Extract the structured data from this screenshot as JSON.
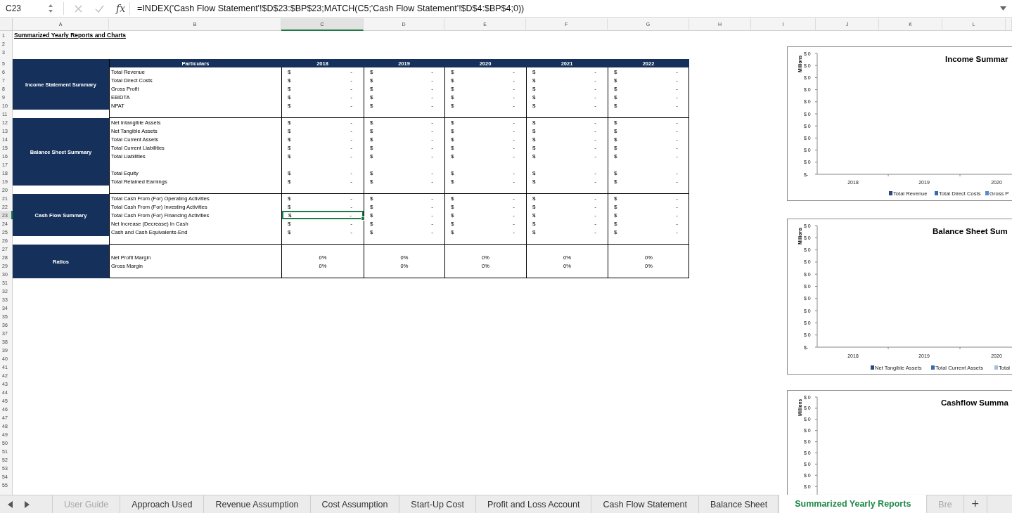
{
  "formula_bar": {
    "name_box": "C23",
    "function_label": "fx",
    "formula": "=INDEX('Cash Flow Statement'!$D$23:$BP$23;MATCH(C5;'Cash Flow Statement'!$D$4:$BP$4;0))"
  },
  "columns": [
    {
      "label": "A",
      "selected": false
    },
    {
      "label": "B",
      "selected": false
    },
    {
      "label": "C",
      "selected": true
    },
    {
      "label": "D",
      "selected": false
    },
    {
      "label": "E",
      "selected": false
    },
    {
      "label": "F",
      "selected": false
    },
    {
      "label": "G",
      "selected": false
    },
    {
      "label": "H",
      "selected": false
    },
    {
      "label": "I",
      "selected": false
    },
    {
      "label": "J",
      "selected": false
    },
    {
      "label": "K",
      "selected": false
    },
    {
      "label": "L",
      "selected": false
    }
  ],
  "row_numbers": [
    {
      "label": "1",
      "selected": false
    },
    {
      "label": "2",
      "selected": false
    },
    {
      "label": "3",
      "selected": false
    },
    {
      "label": "5",
      "selected": false
    },
    {
      "label": "6",
      "selected": false
    },
    {
      "label": "7",
      "selected": false
    },
    {
      "label": "8",
      "selected": false
    },
    {
      "label": "9",
      "selected": false
    },
    {
      "label": "10",
      "selected": false
    },
    {
      "label": "11",
      "selected": false
    },
    {
      "label": "12",
      "selected": false
    },
    {
      "label": "13",
      "selected": false
    },
    {
      "label": "14",
      "selected": false
    },
    {
      "label": "15",
      "selected": false
    },
    {
      "label": "16",
      "selected": false
    },
    {
      "label": "17",
      "selected": false
    },
    {
      "label": "18",
      "selected": false
    },
    {
      "label": "19",
      "selected": false
    },
    {
      "label": "20",
      "selected": false
    },
    {
      "label": "21",
      "selected": false
    },
    {
      "label": "22",
      "selected": false
    },
    {
      "label": "23",
      "selected": true
    },
    {
      "label": "24",
      "selected": false
    },
    {
      "label": "25",
      "selected": false
    },
    {
      "label": "26",
      "selected": false
    },
    {
      "label": "27",
      "selected": false
    },
    {
      "label": "28",
      "selected": false
    },
    {
      "label": "29",
      "selected": false
    },
    {
      "label": "30",
      "selected": false
    },
    {
      "label": "31",
      "selected": false
    },
    {
      "label": "32",
      "selected": false
    },
    {
      "label": "33",
      "selected": false
    },
    {
      "label": "34",
      "selected": false
    },
    {
      "label": "35",
      "selected": false
    },
    {
      "label": "36",
      "selected": false
    },
    {
      "label": "37",
      "selected": false
    },
    {
      "label": "38",
      "selected": false
    },
    {
      "label": "39",
      "selected": false
    },
    {
      "label": "40",
      "selected": false
    },
    {
      "label": "41",
      "selected": false
    },
    {
      "label": "42",
      "selected": false
    },
    {
      "label": "43",
      "selected": false
    },
    {
      "label": "44",
      "selected": false
    },
    {
      "label": "45",
      "selected": false
    },
    {
      "label": "46",
      "selected": false
    },
    {
      "label": "47",
      "selected": false
    },
    {
      "label": "48",
      "selected": false
    },
    {
      "label": "49",
      "selected": false
    },
    {
      "label": "50",
      "selected": false
    },
    {
      "label": "51",
      "selected": false
    },
    {
      "label": "52",
      "selected": false
    },
    {
      "label": "53",
      "selected": false
    },
    {
      "label": "54",
      "selected": false
    },
    {
      "label": "55",
      "selected": false
    }
  ],
  "sheet_title": "Summarized Yearly Reports and Charts",
  "table": {
    "header": "Particulars",
    "years": [
      "2018",
      "2019",
      "2020",
      "2021",
      "2022"
    ],
    "sections": [
      {
        "label": "Income Statement Summary",
        "rows": [
          {
            "kind": "item",
            "label": "Total Revenue",
            "cells": [
              {
                "currency": "$",
                "amount": "-",
                "selected": false
              },
              {
                "currency": "$",
                "amount": "-",
                "selected": false
              },
              {
                "currency": "$",
                "amount": "-",
                "selected": false
              },
              {
                "currency": "$",
                "amount": "-",
                "selected": false
              },
              {
                "currency": "$",
                "amount": "-",
                "selected": false
              }
            ]
          },
          {
            "kind": "item",
            "label": "Total Direct Costs",
            "cells": [
              {
                "currency": "$",
                "amount": "-",
                "selected": false
              },
              {
                "currency": "$",
                "amount": "-",
                "selected": false
              },
              {
                "currency": "$",
                "amount": "-",
                "selected": false
              },
              {
                "currency": "$",
                "amount": "-",
                "selected": false
              },
              {
                "currency": "$",
                "amount": "-",
                "selected": false
              }
            ]
          },
          {
            "kind": "item",
            "label": "Gross Profit",
            "cells": [
              {
                "currency": "$",
                "amount": "-",
                "selected": false
              },
              {
                "currency": "$",
                "amount": "-",
                "selected": false
              },
              {
                "currency": "$",
                "amount": "-",
                "selected": false
              },
              {
                "currency": "$",
                "amount": "-",
                "selected": false
              },
              {
                "currency": "$",
                "amount": "-",
                "selected": false
              }
            ]
          },
          {
            "kind": "item",
            "label": "EBIDTA",
            "cells": [
              {
                "currency": "$",
                "amount": "-",
                "selected": false
              },
              {
                "currency": "$",
                "amount": "-",
                "selected": false
              },
              {
                "currency": "$",
                "amount": "-",
                "selected": false
              },
              {
                "currency": "$",
                "amount": "-",
                "selected": false
              },
              {
                "currency": "$",
                "amount": "-",
                "selected": false
              }
            ]
          },
          {
            "kind": "item",
            "label": "NPAT",
            "cells": [
              {
                "currency": "$",
                "amount": "-",
                "selected": false
              },
              {
                "currency": "$",
                "amount": "-",
                "selected": false
              },
              {
                "currency": "$",
                "amount": "-",
                "selected": false
              },
              {
                "currency": "$",
                "amount": "-",
                "selected": false
              },
              {
                "currency": "$",
                "amount": "-",
                "selected": false
              }
            ]
          }
        ]
      },
      {
        "label": "Balance Sheet Summary",
        "rows": [
          {
            "kind": "item",
            "label": "Net Intangible Assets",
            "cells": [
              {
                "currency": "$",
                "amount": "-",
                "selected": false
              },
              {
                "currency": "$",
                "amount": "-",
                "selected": false
              },
              {
                "currency": "$",
                "amount": "-",
                "selected": false
              },
              {
                "currency": "$",
                "amount": "-",
                "selected": false
              },
              {
                "currency": "$",
                "amount": "-",
                "selected": false
              }
            ]
          },
          {
            "kind": "item",
            "label": "Net Tangible Assets",
            "cells": [
              {
                "currency": "$",
                "amount": "-",
                "selected": false
              },
              {
                "currency": "$",
                "amount": "-",
                "selected": false
              },
              {
                "currency": "$",
                "amount": "-",
                "selected": false
              },
              {
                "currency": "$",
                "amount": "-",
                "selected": false
              },
              {
                "currency": "$",
                "amount": "-",
                "selected": false
              }
            ]
          },
          {
            "kind": "item",
            "label": "Total Current Assets",
            "cells": [
              {
                "currency": "$",
                "amount": "-",
                "selected": false
              },
              {
                "currency": "$",
                "amount": "-",
                "selected": false
              },
              {
                "currency": "$",
                "amount": "-",
                "selected": false
              },
              {
                "currency": "$",
                "amount": "-",
                "selected": false
              },
              {
                "currency": "$",
                "amount": "-",
                "selected": false
              }
            ]
          },
          {
            "kind": "item",
            "label": "Total Current Liabilities",
            "cells": [
              {
                "currency": "$",
                "amount": "-",
                "selected": false
              },
              {
                "currency": "$",
                "amount": "-",
                "selected": false
              },
              {
                "currency": "$",
                "amount": "-",
                "selected": false
              },
              {
                "currency": "$",
                "amount": "-",
                "selected": false
              },
              {
                "currency": "$",
                "amount": "-",
                "selected": false
              }
            ]
          },
          {
            "kind": "item",
            "label": "Total Liabilities",
            "cells": [
              {
                "currency": "$",
                "amount": "-",
                "selected": false
              },
              {
                "currency": "$",
                "amount": "-",
                "selected": false
              },
              {
                "currency": "$",
                "amount": "-",
                "selected": false
              },
              {
                "currency": "$",
                "amount": "-",
                "selected": false
              },
              {
                "currency": "$",
                "amount": "-",
                "selected": false
              }
            ]
          },
          {
            "kind": "gap"
          },
          {
            "kind": "item",
            "label": "Total Equity",
            "cells": [
              {
                "currency": "$",
                "amount": "-",
                "selected": false
              },
              {
                "currency": "$",
                "amount": "-",
                "selected": false
              },
              {
                "currency": "$",
                "amount": "-",
                "selected": false
              },
              {
                "currency": "$",
                "amount": "-",
                "selected": false
              },
              {
                "currency": "$",
                "amount": "-",
                "selected": false
              }
            ]
          },
          {
            "kind": "item",
            "label": "Total Retained Earnings",
            "cells": [
              {
                "currency": "$",
                "amount": "-",
                "selected": false
              },
              {
                "currency": "$",
                "amount": "-",
                "selected": false
              },
              {
                "currency": "$",
                "amount": "-",
                "selected": false
              },
              {
                "currency": "$",
                "amount": "-",
                "selected": false
              },
              {
                "currency": "$",
                "amount": "-",
                "selected": false
              }
            ]
          }
        ]
      },
      {
        "label": "Cash Flow Summary",
        "rows": [
          {
            "kind": "item",
            "label": "Total Cash From (For) Operating Activities",
            "cells": [
              {
                "currency": "$",
                "amount": "-",
                "selected": false
              },
              {
                "currency": "$",
                "amount": "-",
                "selected": false
              },
              {
                "currency": "$",
                "amount": "-",
                "selected": false
              },
              {
                "currency": "$",
                "amount": "-",
                "selected": false
              },
              {
                "currency": "$",
                "amount": "-",
                "selected": false
              }
            ]
          },
          {
            "kind": "item",
            "label": "Total Cash From (For) Investing Activities",
            "cells": [
              {
                "currency": "$",
                "amount": "-",
                "selected": false
              },
              {
                "currency": "$",
                "amount": "-",
                "selected": false
              },
              {
                "currency": "$",
                "amount": "-",
                "selected": false
              },
              {
                "currency": "$",
                "amount": "-",
                "selected": false
              },
              {
                "currency": "$",
                "amount": "-",
                "selected": false
              }
            ]
          },
          {
            "kind": "item",
            "label": "Total Cash From (For) Financing Activities",
            "cells": [
              {
                "currency": "$",
                "amount": "-",
                "selected": true
              },
              {
                "currency": "$",
                "amount": "-",
                "selected": false
              },
              {
                "currency": "$",
                "amount": "-",
                "selected": false
              },
              {
                "currency": "$",
                "amount": "-",
                "selected": false
              },
              {
                "currency": "$",
                "amount": "-",
                "selected": false
              }
            ]
          },
          {
            "kind": "item",
            "label": "Net Increase (Decrease) In Cash",
            "cells": [
              {
                "currency": "$",
                "amount": "-",
                "selected": false
              },
              {
                "currency": "$",
                "amount": "-",
                "selected": false
              },
              {
                "currency": "$",
                "amount": "-",
                "selected": false
              },
              {
                "currency": "$",
                "amount": "-",
                "selected": false
              },
              {
                "currency": "$",
                "amount": "-",
                "selected": false
              }
            ]
          },
          {
            "kind": "item",
            "label": "Cash and Cash Equivalents-End",
            "cells": [
              {
                "currency": "$",
                "amount": "-",
                "selected": false
              },
              {
                "currency": "$",
                "amount": "-",
                "selected": false
              },
              {
                "currency": "$",
                "amount": "-",
                "selected": false
              },
              {
                "currency": "$",
                "amount": "-",
                "selected": false
              },
              {
                "currency": "$",
                "amount": "-",
                "selected": false
              }
            ]
          }
        ]
      },
      {
        "label": "Ratios",
        "rows": [
          {
            "kind": "gap"
          },
          {
            "kind": "ratio",
            "label": "Net Profit Margin",
            "cells": [
              {
                "amount": "0%",
                "selected": false
              },
              {
                "amount": "0%",
                "selected": false
              },
              {
                "amount": "0%",
                "selected": false
              },
              {
                "amount": "0%",
                "selected": false
              },
              {
                "amount": "0%",
                "selected": false
              }
            ]
          },
          {
            "kind": "ratio",
            "label": "Gross Margin",
            "cells": [
              {
                "amount": "0%",
                "selected": false
              },
              {
                "amount": "0%",
                "selected": false
              },
              {
                "amount": "0%",
                "selected": false
              },
              {
                "amount": "0%",
                "selected": false
              },
              {
                "amount": "0%",
                "selected": false
              }
            ]
          },
          {
            "kind": "gap"
          }
        ]
      }
    ]
  },
  "charts": [
    {
      "title": "Income Summar",
      "ylabel": "Millions",
      "yticks": [
        "$ 0",
        "$ 0",
        "$ 0",
        "$ 0",
        "$ 0",
        "$ 0",
        "$ 0",
        "$ 0",
        "$ 0",
        "$ 0",
        "$-"
      ],
      "categories": [
        "2018",
        "2019",
        "2020"
      ],
      "legend": [
        {
          "label": "Total Revenue",
          "color": "#2e4a7d"
        },
        {
          "label": "Total Direct Costs",
          "color": "#3c6aa8"
        },
        {
          "label": "Gross P",
          "color": "#5a8ad0"
        }
      ]
    },
    {
      "title": "Balance Sheet Sum",
      "ylabel": "Millions",
      "yticks": [
        "$ 0",
        "$ 0",
        "$ 0",
        "$ 0",
        "$ 0",
        "$ 0",
        "$ 0",
        "$ 0",
        "$ 0",
        "$ 0",
        "$-"
      ],
      "categories": [
        "2018",
        "2019",
        "2020"
      ],
      "legend": [
        {
          "label": "Net Tangible Assets",
          "color": "#2e4a7d"
        },
        {
          "label": "Total Current Assets",
          "color": "#3c6aa8"
        },
        {
          "label": "Total",
          "color": "#a8bbd8"
        }
      ]
    },
    {
      "title": "Cashflow Summa",
      "ylabel": "Millions",
      "yticks": [
        "$ 0",
        "$ 0",
        "$ 0",
        "$ 0",
        "$ 0",
        "$ 0",
        "$ 0",
        "$ 0",
        "$ 0"
      ]
    }
  ],
  "sheet_tabs": [
    {
      "label": "User Guide",
      "selected": false,
      "faded": true
    },
    {
      "label": "Approach Used",
      "selected": false,
      "faded": false
    },
    {
      "label": "Revenue Assumption",
      "selected": false,
      "faded": false
    },
    {
      "label": "Cost Assumption",
      "selected": false,
      "faded": false
    },
    {
      "label": "Start-Up Cost",
      "selected": false,
      "faded": false
    },
    {
      "label": "Profit and Loss Account",
      "selected": false,
      "faded": false
    },
    {
      "label": "Cash Flow Statement",
      "selected": false,
      "faded": false
    },
    {
      "label": "Balance Sheet",
      "selected": false,
      "faded": false
    },
    {
      "label": "Summarized Yearly Reports",
      "selected": true,
      "faded": false
    },
    {
      "label": "Bre",
      "selected": false,
      "faded": true
    }
  ],
  "add_sheet": "+"
}
